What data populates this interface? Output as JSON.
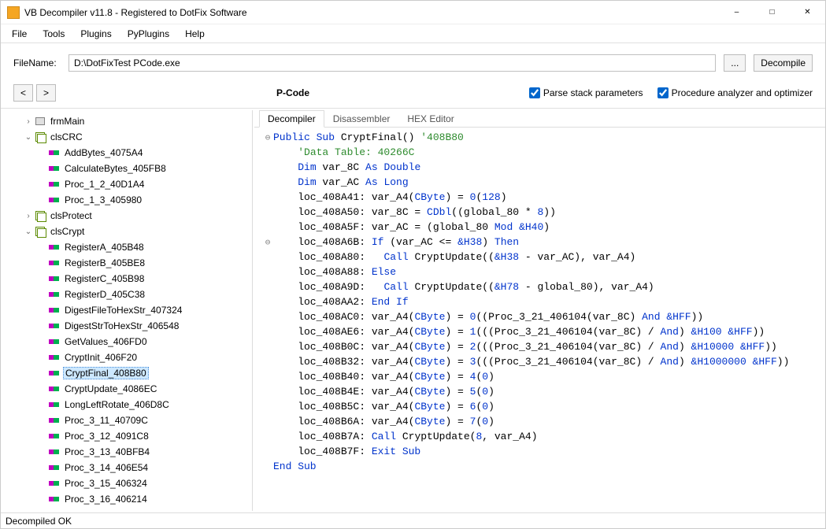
{
  "window": {
    "title": "VB Decompiler v11.8 - Registered to DotFix Software"
  },
  "menu": [
    "File",
    "Tools",
    "Plugins",
    "PyPlugins",
    "Help"
  ],
  "file": {
    "label": "FileName:",
    "value": "D:\\DotFixTest PCode.exe",
    "browse": "...",
    "decompile": "Decompile"
  },
  "nav": {
    "back": "<",
    "fwd": ">"
  },
  "mode": "P-Code",
  "options": {
    "parse_stack": "Parse stack parameters",
    "proc_optimizer": "Procedure analyzer and optimizer"
  },
  "tree": [
    {
      "depth": 1,
      "tw": ">",
      "icon": "form",
      "label": "frmMain"
    },
    {
      "depth": 1,
      "tw": "v",
      "icon": "class",
      "label": "clsCRC"
    },
    {
      "depth": 2,
      "tw": "",
      "icon": "method",
      "label": "AddBytes_4075A4"
    },
    {
      "depth": 2,
      "tw": "",
      "icon": "method",
      "label": "CalculateBytes_405FB8"
    },
    {
      "depth": 2,
      "tw": "",
      "icon": "method",
      "label": "Proc_1_2_40D1A4"
    },
    {
      "depth": 2,
      "tw": "",
      "icon": "method",
      "label": "Proc_1_3_405980"
    },
    {
      "depth": 1,
      "tw": ">",
      "icon": "class",
      "label": "clsProtect"
    },
    {
      "depth": 1,
      "tw": "v",
      "icon": "class",
      "label": "clsCrypt"
    },
    {
      "depth": 2,
      "tw": "",
      "icon": "method",
      "label": "RegisterA_405B48"
    },
    {
      "depth": 2,
      "tw": "",
      "icon": "method",
      "label": "RegisterB_405BE8"
    },
    {
      "depth": 2,
      "tw": "",
      "icon": "method",
      "label": "RegisterC_405B98"
    },
    {
      "depth": 2,
      "tw": "",
      "icon": "method",
      "label": "RegisterD_405C38"
    },
    {
      "depth": 2,
      "tw": "",
      "icon": "method",
      "label": "DigestFileToHexStr_407324"
    },
    {
      "depth": 2,
      "tw": "",
      "icon": "method",
      "label": "DigestStrToHexStr_406548"
    },
    {
      "depth": 2,
      "tw": "",
      "icon": "method",
      "label": "GetValues_406FD0"
    },
    {
      "depth": 2,
      "tw": "",
      "icon": "method",
      "label": "CryptInit_406F20"
    },
    {
      "depth": 2,
      "tw": "",
      "icon": "method",
      "label": "CryptFinal_408B80",
      "selected": true
    },
    {
      "depth": 2,
      "tw": "",
      "icon": "method",
      "label": "CryptUpdate_4086EC"
    },
    {
      "depth": 2,
      "tw": "",
      "icon": "method",
      "label": "LongLeftRotate_406D8C"
    },
    {
      "depth": 2,
      "tw": "",
      "icon": "method",
      "label": "Proc_3_11_40709C"
    },
    {
      "depth": 2,
      "tw": "",
      "icon": "method",
      "label": "Proc_3_12_4091C8"
    },
    {
      "depth": 2,
      "tw": "",
      "icon": "method",
      "label": "Proc_3_13_40BFB4"
    },
    {
      "depth": 2,
      "tw": "",
      "icon": "method",
      "label": "Proc_3_14_406E54"
    },
    {
      "depth": 2,
      "tw": "",
      "icon": "method",
      "label": "Proc_3_15_406324"
    },
    {
      "depth": 2,
      "tw": "",
      "icon": "method",
      "label": "Proc_3_16_406214"
    }
  ],
  "tabs": [
    "Decompiler",
    "Disassembler",
    "HEX Editor"
  ],
  "activeTab": 0,
  "code": [
    {
      "g": "⊖",
      "t": {
        "pre": "",
        "kw1": "Public Sub",
        "mid": " CryptFinal() ",
        "cm": "'408B80"
      }
    },
    {
      "g": "",
      "t": {
        "pre": "    ",
        "cm": "'Data Table: 40266C"
      }
    },
    {
      "g": "",
      "t": {
        "pre": "    ",
        "kw1": "Dim",
        "mid": " var_8C ",
        "kw2": "As Double"
      }
    },
    {
      "g": "",
      "t": {
        "pre": "    ",
        "kw1": "Dim",
        "mid": " var_AC ",
        "kw2": "As Long"
      }
    },
    {
      "g": "",
      "t": {
        "pre": "    loc_408A41: var_A4(",
        "num1": "0",
        "mid": ") = ",
        "kw1": "CByte",
        "post": "(",
        "num2": "128",
        "end": ")"
      }
    },
    {
      "g": "",
      "t": {
        "pre": "    loc_408A50: var_8C = ",
        "kw1": "CDbl",
        "mid": "((global_80 * ",
        "num1": "8",
        "end": "))"
      }
    },
    {
      "g": "",
      "t": {
        "pre": "    loc_408A5F: var_AC = (global_80 ",
        "kw1": "Mod",
        "mid": " ",
        "num1": "&H40",
        "end": ")"
      }
    },
    {
      "g": "⊖",
      "t": {
        "pre": "    loc_408A6B: ",
        "kw1": "If",
        "mid": " (var_AC <= ",
        "num1": "&H38",
        "post": ") ",
        "kw2": "Then"
      }
    },
    {
      "g": "",
      "t": {
        "pre": "    loc_408A80:   ",
        "kw1": "Call",
        "mid": " CryptUpdate((",
        "num1": "&H38",
        "end": " - var_AC), var_A4)"
      }
    },
    {
      "g": "",
      "t": {
        "pre": "    loc_408A88: ",
        "kw1": "Else"
      }
    },
    {
      "g": "",
      "t": {
        "pre": "    loc_408A9D:   ",
        "kw1": "Call",
        "mid": " CryptUpdate((",
        "num1": "&H78",
        "end": " - global_80), var_A4)"
      }
    },
    {
      "g": "",
      "t": {
        "pre": "    loc_408AA2: ",
        "kw1": "End If"
      }
    },
    {
      "g": "",
      "t": {
        "pre": "    loc_408AC0: var_A4(",
        "num1": "0",
        "mid": ") = ",
        "kw1": "CByte",
        "post": "((Proc_3_21_406104(var_8C) ",
        "kw2": "And",
        "post2": " ",
        "num2": "&HFF",
        "end": "))"
      }
    },
    {
      "g": "",
      "t": {
        "pre": "    loc_408AE6: var_A4(",
        "num1": "1",
        "mid": ") = ",
        "kw1": "CByte",
        "post": "(((Proc_3_21_406104(var_8C) / ",
        "num2": "&H100",
        "post2": ") ",
        "kw2": "And",
        "post3": " ",
        "num3": "&HFF",
        "end": "))"
      }
    },
    {
      "g": "",
      "t": {
        "pre": "    loc_408B0C: var_A4(",
        "num1": "2",
        "mid": ") = ",
        "kw1": "CByte",
        "post": "(((Proc_3_21_406104(var_8C) / ",
        "num2": "&H10000",
        "post2": ") ",
        "kw2": "And",
        "post3": " ",
        "num3": "&HFF",
        "end": "))"
      }
    },
    {
      "g": "",
      "t": {
        "pre": "    loc_408B32: var_A4(",
        "num1": "3",
        "mid": ") = ",
        "kw1": "CByte",
        "post": "(((Proc_3_21_406104(var_8C) / ",
        "num2": "&H1000000",
        "post2": ") ",
        "kw2": "And",
        "post3": " ",
        "num3": "&HFF",
        "end": "))"
      }
    },
    {
      "g": "",
      "t": {
        "pre": "    loc_408B40: var_A4(",
        "num1": "4",
        "mid": ") = ",
        "kw1": "CByte",
        "post": "(",
        "num2": "0",
        "end": ")"
      }
    },
    {
      "g": "",
      "t": {
        "pre": "    loc_408B4E: var_A4(",
        "num1": "5",
        "mid": ") = ",
        "kw1": "CByte",
        "post": "(",
        "num2": "0",
        "end": ")"
      }
    },
    {
      "g": "",
      "t": {
        "pre": "    loc_408B5C: var_A4(",
        "num1": "6",
        "mid": ") = ",
        "kw1": "CByte",
        "post": "(",
        "num2": "0",
        "end": ")"
      }
    },
    {
      "g": "",
      "t": {
        "pre": "    loc_408B6A: var_A4(",
        "num1": "7",
        "mid": ") = ",
        "kw1": "CByte",
        "post": "(",
        "num2": "0",
        "end": ")"
      }
    },
    {
      "g": "",
      "t": {
        "pre": "    loc_408B7A: ",
        "kw1": "Call",
        "mid": " CryptUpdate(",
        "num1": "8",
        "end": ", var_A4)"
      }
    },
    {
      "g": "",
      "t": {
        "pre": "    loc_408B7F: ",
        "kw1": "Exit Sub"
      }
    },
    {
      "g": "",
      "t": {
        "kw1": "End Sub"
      }
    }
  ],
  "status": "Decompiled OK"
}
